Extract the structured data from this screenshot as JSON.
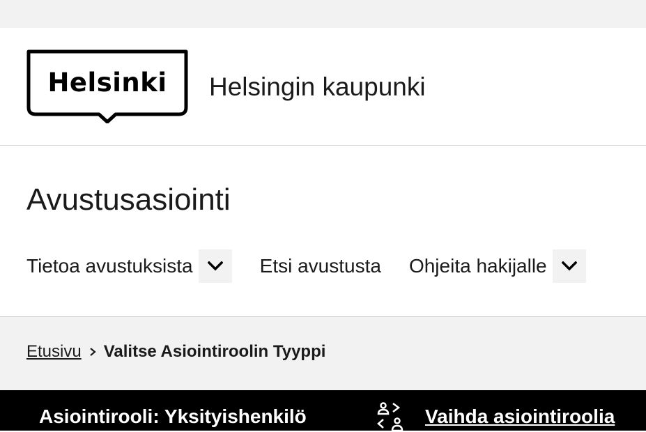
{
  "header": {
    "logo_text": "Helsinki",
    "site_name": "Helsingin kaupunki"
  },
  "service": {
    "title": "Avustusasiointi"
  },
  "nav": {
    "items": [
      {
        "label": "Tietoa avustuksista",
        "has_dropdown": true
      },
      {
        "label": "Etsi avustusta",
        "has_dropdown": false
      },
      {
        "label": "Ohjeita hakijalle",
        "has_dropdown": true
      }
    ]
  },
  "breadcrumb": {
    "home": "Etusivu",
    "current": "Valitse Asiointiroolin Tyyppi"
  },
  "role_bar": {
    "role_label": "Asiointirooli: Yksityishenkilö",
    "switch_label": "Vaihda asiointiroolia",
    "switch_icon": "switch-role-icon"
  },
  "colors": {
    "top_strip": "#f2f2f2",
    "breadcrumb_bg": "#f2f2f2",
    "role_bar_bg": "#000000",
    "role_bar_text": "#ffffff",
    "text": "#1a1a1a"
  }
}
